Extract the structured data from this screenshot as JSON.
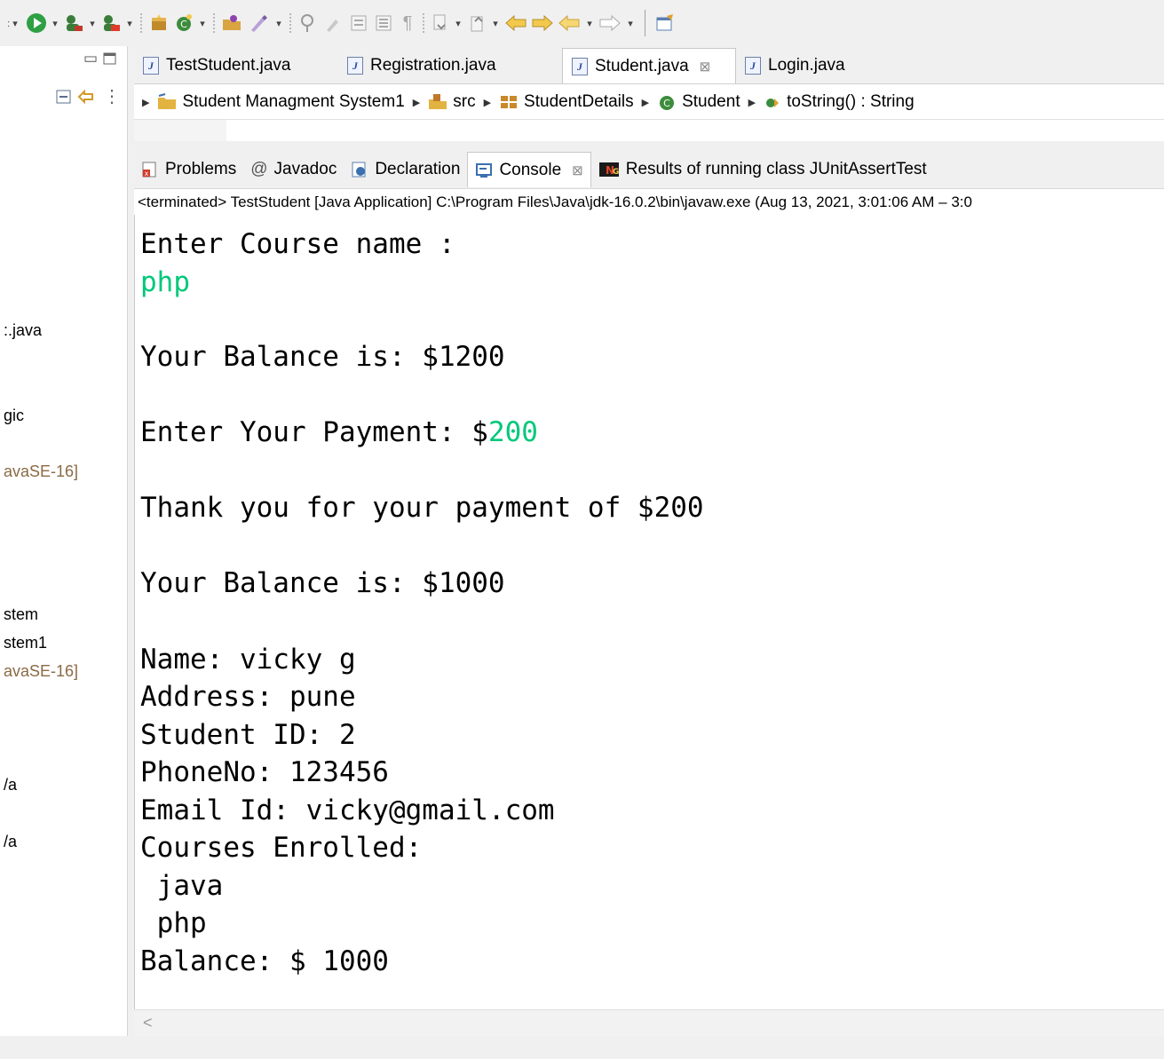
{
  "toolbar": {
    "icons": [
      "run-icon",
      "debug-icon",
      "coverage-icon",
      "new-package-icon",
      "new-class-icon",
      "open-type-icon",
      "search-icon",
      "toggle-mark-icon",
      "show-whitespace-icon",
      "next-annotation-icon",
      "back-icon",
      "forward-icon",
      "pin-editor-icon"
    ]
  },
  "left_panel": {
    "items": [
      ":.java",
      "gic",
      "avaSE-16]",
      "stem",
      "stem1",
      "avaSE-16]",
      "/a",
      "/a"
    ]
  },
  "editor_tabs": [
    {
      "label": "TestStudent.java",
      "active": false
    },
    {
      "label": "Registration.java",
      "active": false
    },
    {
      "label": "Student.java",
      "active": true,
      "close": "⊠"
    },
    {
      "label": "Login.java",
      "active": false
    }
  ],
  "breadcrumb": {
    "project": "Student Managment System1",
    "folder": "src",
    "package": "StudentDetails",
    "class": "Student",
    "method": "toString() : String"
  },
  "view_tabs": [
    {
      "label": "Problems"
    },
    {
      "label": "Javadoc"
    },
    {
      "label": "Declaration"
    },
    {
      "label": "Console",
      "active": true,
      "close": "⊠"
    },
    {
      "label": "Results of running class JUnitAssertTest"
    }
  ],
  "console": {
    "header": "<terminated> TestStudent [Java Application] C:\\Program Files\\Java\\jdk-16.0.2\\bin\\javaw.exe  (Aug 13, 2021, 3:01:06 AM – 3:0",
    "lines": {
      "course_prompt": "Enter Course name :",
      "course_input": "php",
      "balance1": "Your Balance is: $1200",
      "payment_prompt": "Enter Your Payment: $",
      "payment_input": "200",
      "thanks": "Thank you for your payment of $200",
      "balance2": "Your Balance is: $1000",
      "name": "Name: vicky g",
      "address": "Address: pune",
      "student_id": "Student ID: 2",
      "phone": "PhoneNo: 123456",
      "email": "Email Id: vicky@gmail.com",
      "courses_header": "Courses Enrolled:",
      "course1": " java",
      "course2": " php",
      "balance3": "Balance: $ 1000"
    },
    "input_color": "#00c87a"
  },
  "scroll": {
    "left_arrow": "<"
  }
}
